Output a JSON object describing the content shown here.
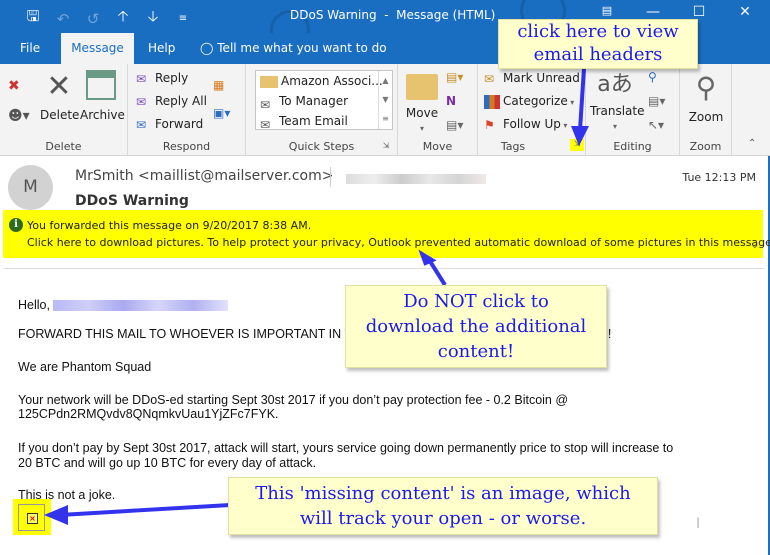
{
  "window": {
    "title": "DDoS Warning  -  Message (HTML)",
    "controls": [
      "restore-ribbon-icon",
      "minimize-icon",
      "maximize-icon",
      "close-icon"
    ]
  },
  "quick_access": [
    "save-icon",
    "undo-icon",
    "redo-icon",
    "previous-item-icon",
    "next-item-icon",
    "customize-icon"
  ],
  "tabs": [
    {
      "label": "File",
      "active": false
    },
    {
      "label": "Message",
      "active": true
    },
    {
      "label": "Help",
      "active": false
    }
  ],
  "tell_me": "Tell me what you want to do",
  "ribbon": {
    "delete_group": {
      "label": "Delete",
      "delete_btn": "Delete",
      "archive_btn": "Archive"
    },
    "respond_group": {
      "label": "Respond",
      "reply": "Reply",
      "reply_all": "Reply All",
      "forward": "Forward"
    },
    "quick_steps_group": {
      "label": "Quick Steps",
      "items": [
        "Amazon Associ...",
        "To Manager",
        "Team Email"
      ]
    },
    "move_group": {
      "label": "Move",
      "move_btn": "Move"
    },
    "tags_group": {
      "label": "Tags",
      "mark_unread": "Mark Unread",
      "categorize": "Categorize",
      "follow_up": "Follow Up"
    },
    "editing_group": {
      "label": "Editing",
      "translate": "Translate"
    },
    "zoom_group": {
      "label": "Zoom",
      "zoom_btn": "Zoom"
    }
  },
  "message": {
    "avatar_initial": "M",
    "sender": "MrSmith <maillist@mailserver.com>",
    "time": "Tue 12:13 PM",
    "subject": "DDoS Warning",
    "info_line1": "You forwarded this message on 9/20/2017 8:38 AM.",
    "info_line2": "Click here to download pictures. To help protect your privacy, Outlook prevented automatic download of some pictures in this message.",
    "body": {
      "greeting": "Hello,",
      "p1": "FORWARD THIS MAIL TO WHOEVER IS IMPORTANT IN YOUR COMPANY AND CAN MAKE DECISION!",
      "p1_visible_end": "CISION!",
      "p2": "We are Phantom Squad",
      "p3a": "Your network will be DDoS-ed starting Sept 30st 2017 if you don’t pay protection fee - 0.2 Bitcoin @",
      "p3b": "125CPdn2RMQvdv8QNqmkvUau1YjZFc7FYK.",
      "p4a": "If you don’t pay by Sept 30st 2017, attack will start, yours service going down permanently price to stop will increase to",
      "p4b": "20 BTC and will go up 10 BTC for every day of attack.",
      "p5": "This is not a joke."
    }
  },
  "annotations": {
    "headers": [
      "click here to view",
      "email headers"
    ],
    "download": [
      "Do NOT click to",
      "download the additional",
      "content!"
    ],
    "image": [
      "This 'missing content' is an image, which",
      "will track your open - or worse."
    ]
  },
  "colors": {
    "accent": "#1a6ec2",
    "highlight": "#ffff00",
    "callout_bg": "#ffffcc",
    "callout_text": "#1a1aee"
  }
}
